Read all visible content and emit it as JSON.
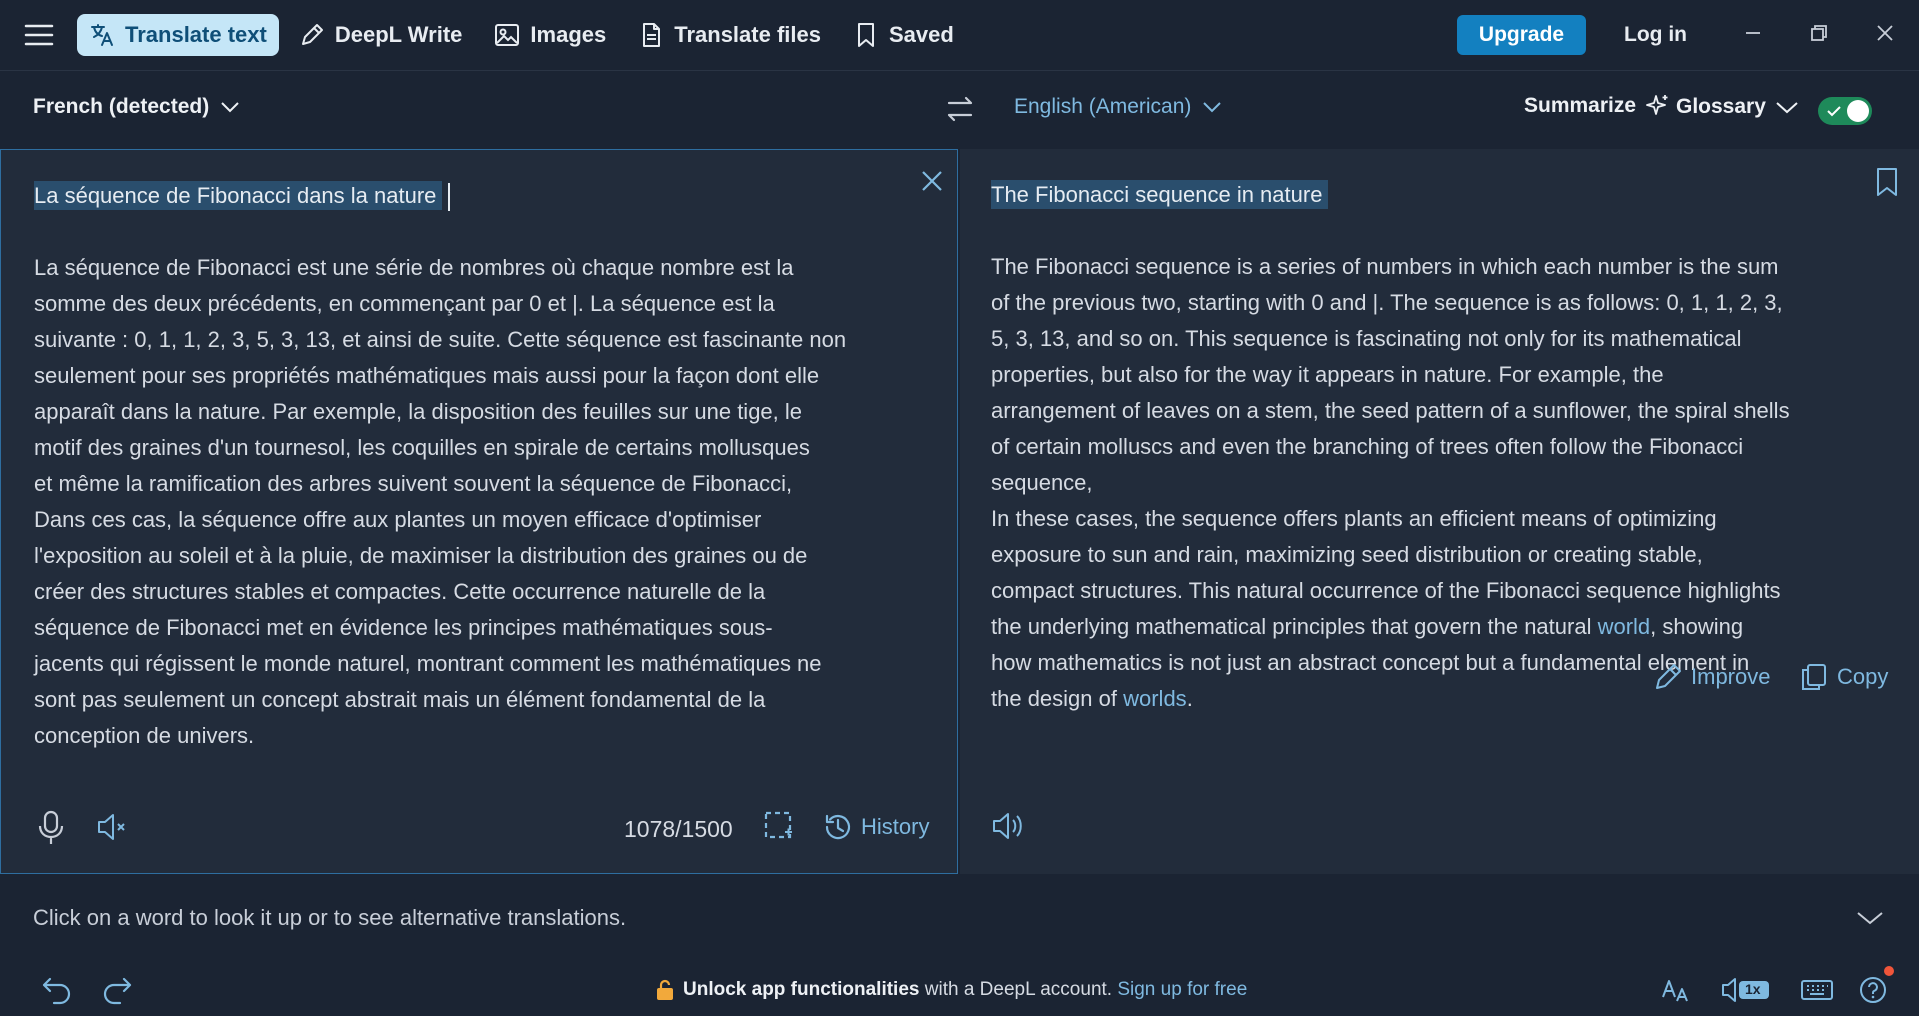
{
  "nav": {
    "items": [
      {
        "label": "Translate text",
        "icon": "translate-icon",
        "active": true
      },
      {
        "label": "DeepL Write",
        "icon": "pencil-icon",
        "active": false
      },
      {
        "label": "Images",
        "icon": "image-icon",
        "active": false
      },
      {
        "label": "Translate files",
        "icon": "file-icon",
        "active": false
      },
      {
        "label": "Saved",
        "icon": "bookmark-icon",
        "active": false
      }
    ],
    "upgrade_label": "Upgrade",
    "login_label": "Log in"
  },
  "langbar": {
    "source_lang": "French (detected)",
    "target_lang": "English (American)",
    "summarize_label": "Summarize",
    "glossary_label": "Glossary",
    "toggle_on": true
  },
  "source": {
    "title": "La séquence de Fibonacci dans la nature",
    "body": "La séquence de Fibonacci est une série de nombres où chaque nombre est la\nsomme des deux précédents, en commençant par 0 et |. La séquence est la\nsuivante : 0, 1, 1, 2, 3, 5, 3, 13, et ainsi de suite. Cette séquence est fascinante non\nseulement pour ses propriétés mathématiques mais aussi pour la façon dont elle\napparaît dans la nature. Par exemple, la disposition des feuilles sur une tige, le\nmotif des graines d'un tournesol, les coquilles en spirale de certains mollusques\net même la ramification des arbres suivent souvent la séquence de Fibonacci,\nDans ces cas, la séquence offre aux plantes un moyen efficace d'optimiser\nl'exposition au soleil et à la pluie, de maximiser la distribution des graines ou de\ncréer des structures stables et compactes. Cette occurrence naturelle de la\nséquence de Fibonacci met en évidence les principes mathématiques sous-\njacents qui régissent le monde naturel, montrant comment les mathématiques ne\nsont pas seulement un concept abstrait mais un élément fondamental de la\nconception de univers.",
    "char_count": "1078/1500",
    "history_label": "History"
  },
  "target": {
    "title": "The Fibonacci sequence in nature",
    "body_part1": "The Fibonacci sequence is a series of numbers in which each number is the sum\nof the previous two, starting with 0 and |. The sequence is as follows: 0, 1, 1, 2, 3,\n5, 3, 13, and so on. This sequence is fascinating not only for its mathematical\nproperties, but also for the way it appears in nature. For example, the\narrangement of leaves on a stem, the seed pattern of a sunflower, the spiral shells\nof certain molluscs and even the branching of trees often follow the Fibonacci\nsequence,\nIn these cases, the sequence offers plants an efficient means of optimizing\nexposure to sun and rain, maximizing seed distribution or creating stable,\ncompact structures. This natural occurrence of the Fibonacci sequence highlights\nthe underlying mathematical principles that govern the natural ",
    "link1": "world",
    "body_part2": ", showing\nhow mathematics is not just an abstract concept but a fundamental element in\nthe design of ",
    "link2": "worlds",
    "body_part3": ".",
    "improve_label": "Improve",
    "copy_label": "Copy"
  },
  "lookup": {
    "hint": "Click on a word to look it up or to see alternative translations."
  },
  "footer": {
    "unlock_bold": "Unlock app functionalities",
    "unlock_rest": " with a DeepL account. ",
    "signup_label": "Sign up for free",
    "speed_label": "1x"
  },
  "colors": {
    "background": "#1b2433",
    "panel": "#222c3b",
    "accent": "#1380c0",
    "link": "#7fb9e0",
    "highlight": "#2a4e6d",
    "toggle": "#1e8a5a"
  }
}
